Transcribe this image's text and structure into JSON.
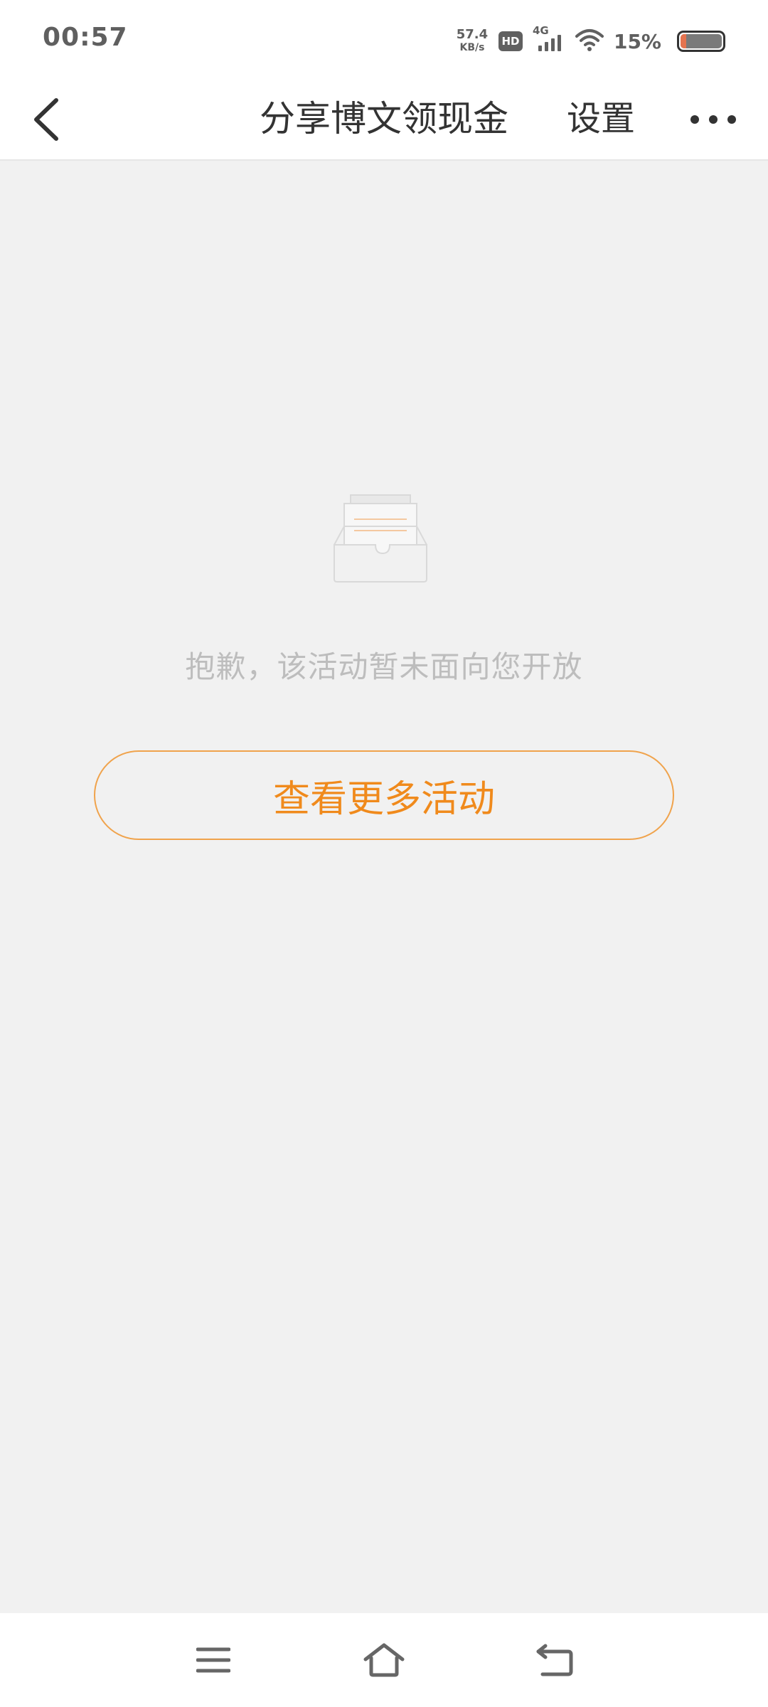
{
  "status_bar": {
    "time": "00:57",
    "net_speed_value": "57.4",
    "net_speed_unit": "KB/s",
    "hd_label": "HD",
    "network_label": "4G",
    "battery_percent": "15%",
    "battery_level": 0.15
  },
  "nav": {
    "title": "分享博文领现金",
    "settings_label": "设置"
  },
  "content": {
    "empty_message": "抱歉，该活动暂未面向您开放",
    "button_label": "查看更多活动"
  },
  "colors": {
    "accent": "#f08a1c",
    "accent_border": "#f0a34c",
    "background": "#f1f1f1"
  },
  "icons": {
    "back": "chevron-left-icon",
    "more": "more-dots-icon",
    "empty": "empty-inbox-icon",
    "menu": "menu-icon",
    "home": "home-icon",
    "return": "return-icon"
  }
}
